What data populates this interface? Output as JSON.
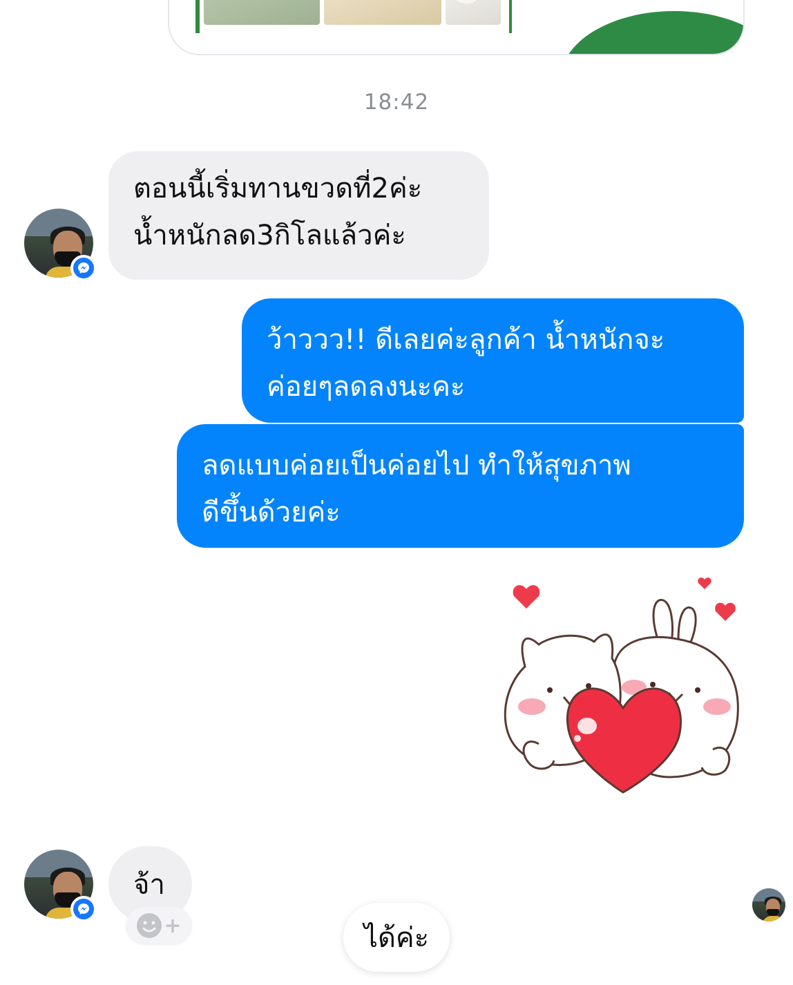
{
  "shared_card": {
    "type": "product-image-preview"
  },
  "timestamp": "18:42",
  "messages": [
    {
      "side": "incoming",
      "lines": [
        "ตอนนี้เริ่มทานขวดที่2ค่ะ",
        "น้ำหนักลด3กิโลแล้วค่ะ"
      ]
    },
    {
      "side": "outgoing",
      "lines": [
        "ว้าววว!! ดีเลยค่ะลูกค้า น้ำหนักจะ",
        "ค่อยๆลดลงนะคะ"
      ]
    },
    {
      "side": "outgoing",
      "lines": [
        "ลดแบบค่อยเป็นค่อยไป ทำให้สุขภาพ",
        "ดีขึ้นด้วยค่ะ"
      ]
    },
    {
      "side": "outgoing",
      "type": "sticker",
      "sticker": "cat-and-bunny-hugging-heart"
    },
    {
      "side": "incoming",
      "lines": [
        "จ้า"
      ]
    }
  ],
  "reaction_button": {
    "icon": "smiley-add-icon",
    "label": "+"
  },
  "quick_reply": "ได้ค่ะ",
  "colors": {
    "outgoing": "#0384fc",
    "incoming": "#efeff2",
    "badge": "#1677ff",
    "timestamp": "#8a8d91"
  }
}
